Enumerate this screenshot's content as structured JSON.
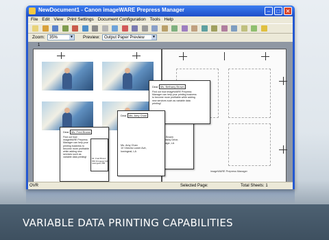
{
  "window": {
    "title": "NewDocument1 - Canon imageWARE Prepress Manager",
    "min": "–",
    "max": "□",
    "close": "✕"
  },
  "menu": [
    "File",
    "Edit",
    "View",
    "Print Settings",
    "Document Configuration",
    "Tools",
    "Help"
  ],
  "toolbar_icons": [
    "new-icon",
    "open-icon",
    "save-icon",
    "print-icon",
    "undo-icon",
    "redo-icon",
    "cut-icon",
    "copy-icon",
    "paste-icon",
    "delete-icon",
    "layout-icon",
    "layout2-icon",
    "layout3-icon",
    "layout4-icon",
    "layout5-icon",
    "layout6-icon",
    "layout7-icon",
    "layout8-icon",
    "layout9-icon",
    "layout10-icon",
    "layout11-icon",
    "layout12-icon",
    "layout13-icon",
    "help-icon"
  ],
  "options": {
    "zoom_label": "Zoom:",
    "zoom_value": "35%",
    "preview_label": "Preview:",
    "preview_value": "Output Paper Preview"
  },
  "canvas": {
    "page_number": "1"
  },
  "docs": {
    "d1": {
      "dear": "Dear",
      "name": "Ms. Bethany Brown",
      "body": "Find out how imageWARE Prepress Manager can help your printing business to become more profitable while adding new services such as variable data printing!",
      "addr": "Mr. Kathia Brown\n1635 Brightsby Drive,\nMallon Village, LA"
    },
    "d2": {
      "dear": "Dear",
      "name": "Ms. Amy Chan",
      "addr": "Ms. Amy Chan\n10 Victoria Lower Ave,\nIowingeat, LA"
    },
    "d3": {
      "dear": "Dear",
      "name": "Ms. Fred Brown",
      "body": "Find out how imageWARE Prepress Manager can help your printing business to become more profitable while adding new services such as variable data printing!",
      "addr": "Mr. Fred Brown\n650 Fringeger Rd,\nIowingeat, MB"
    }
  },
  "right_page_footer": "imageWARE Prepress Manager",
  "status": {
    "left": "OVR",
    "selected": "Selected Page:",
    "total": "Total Sheets: 1"
  },
  "caption": "VARIABLE DATA PRINTING CAPABILITIES"
}
